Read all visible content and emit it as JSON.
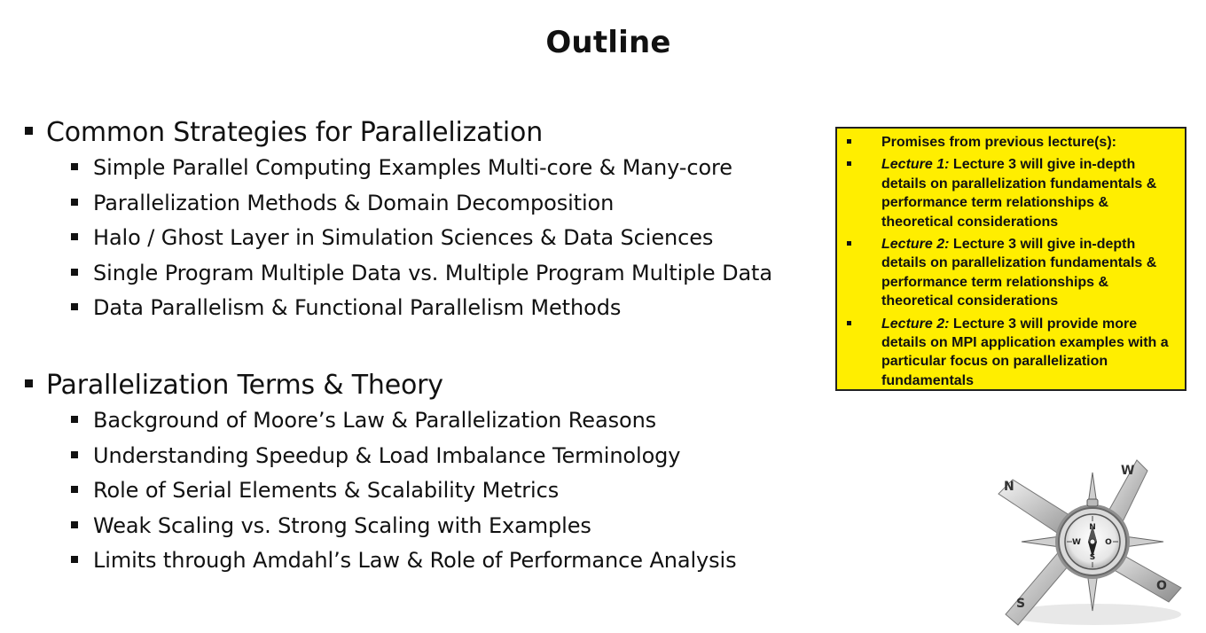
{
  "title": "Outline",
  "sections": [
    {
      "heading": "Common Strategies for Parallelization",
      "items": [
        "Simple Parallel Computing Examples Multi-core & Many-core",
        "Parallelization Methods & Domain Decomposition",
        "Halo / Ghost Layer in Simulation Sciences & Data Sciences",
        "Single Program Multiple Data vs. Multiple Program Multiple Data",
        "Data Parallelism & Functional Parallelism Methods"
      ]
    },
    {
      "heading": "Parallelization Terms & Theory",
      "items": [
        "Background of Moore’s Law & Parallelization Reasons",
        "Understanding Speedup & Load Imbalance Terminology",
        "Role of Serial Elements & Scalability Metrics",
        "Weak Scaling vs. Strong Scaling with Examples",
        "Limits through Amdahl’s Law & Role of Performance Analysis"
      ]
    }
  ],
  "promises": {
    "heading": "Promises from previous lecture(s):",
    "items": [
      {
        "lecture": "Lecture 1:",
        "text": " Lecture 3 will give in-depth details on parallelization fundamentals & performance term relationships & theoretical considerations"
      },
      {
        "lecture": "Lecture 2:",
        "text": " Lecture 3 will give in-depth details on parallelization fundamentals & performance term relationships & theoretical considerations"
      },
      {
        "lecture": "Lecture 2:",
        "text": " Lecture 3 will provide more details on MPI application examples with a particular focus on parallelization fundamentals"
      }
    ]
  },
  "compass_letters": [
    "N",
    "S",
    "O",
    "W",
    "N",
    "O",
    "S",
    "W"
  ],
  "colors": {
    "promo_background": "#ffee00",
    "text": "#111111"
  }
}
